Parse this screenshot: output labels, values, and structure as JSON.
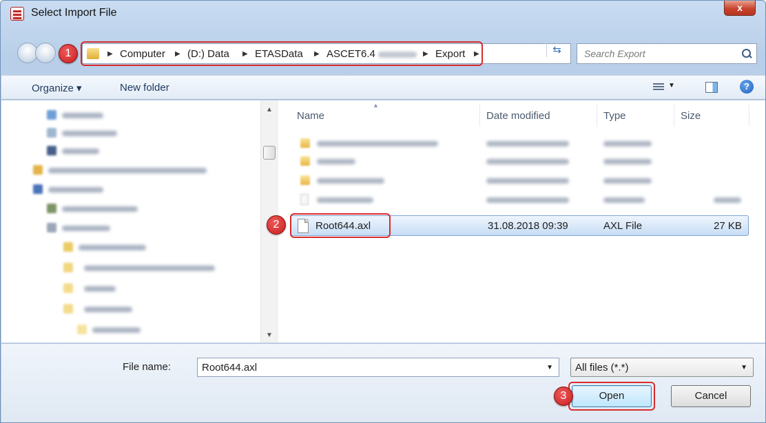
{
  "window": {
    "title": "Select Import File",
    "close_label": "x"
  },
  "address": {
    "crumbs": [
      "Computer",
      "(D:) Data",
      "ETASData",
      "ASCET6.4",
      "Export"
    ],
    "search_placeholder": "Search Export"
  },
  "toolbar": {
    "organize_label": "Organize ▾",
    "new_folder_label": "New folder"
  },
  "columns": {
    "name": "Name",
    "date": "Date modified",
    "type": "Type",
    "size": "Size"
  },
  "selected_file": {
    "name": "Root644.axl",
    "date": "31.08.2018 09:39",
    "type": "AXL File",
    "size": "27 KB"
  },
  "footer": {
    "file_name_label": "File name:",
    "file_name_value": "Root644.axl",
    "file_type_value": "All files (*.*)",
    "open_label": "Open",
    "cancel_label": "Cancel"
  },
  "callouts": [
    "1",
    "2",
    "3"
  ],
  "colors": {
    "callout": "#d92b2b",
    "selection": "#c7ddf5",
    "chrome": "#c9dcf2"
  }
}
